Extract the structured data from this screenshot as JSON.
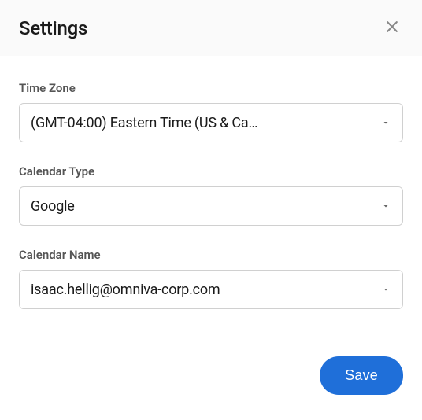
{
  "header": {
    "title": "Settings"
  },
  "fields": {
    "timezone": {
      "label": "Time Zone",
      "value": "(GMT-04:00) Eastern Time (US & Ca…"
    },
    "calendar_type": {
      "label": "Calendar Type",
      "value": "Google"
    },
    "calendar_name": {
      "label": "Calendar Name",
      "value": "isaac.hellig@omniva-corp.com"
    }
  },
  "buttons": {
    "save": "Save"
  }
}
